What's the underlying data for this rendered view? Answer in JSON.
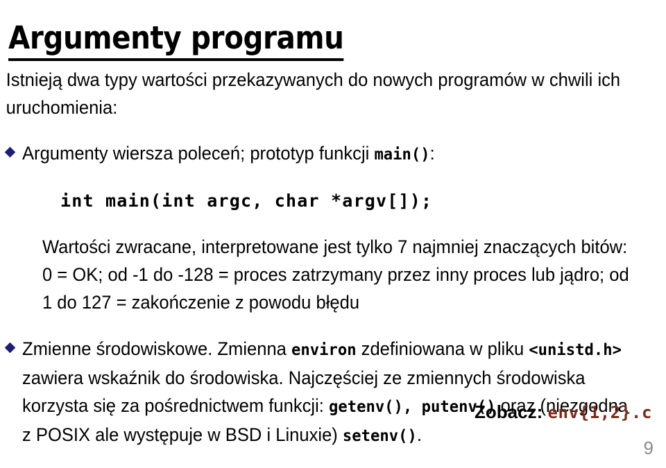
{
  "slide": {
    "title": "Argumenty programu",
    "page_number": "9",
    "bullet_color": "#1d1d78",
    "code_accent_color": "#7b2a18",
    "page_number_color": "#8a8a8a"
  },
  "intro": {
    "text": "Istnieją dwa typy wartości przekazywanych do nowych programów w chwili ich uruchomienia:"
  },
  "bullets": [
    {
      "lead_text": "Argumenty wiersza poleceń; prototyp funkcji ",
      "lead_mono": "main()",
      "lead_tail": ":",
      "code_line": "int main(int argc, char *argv[]);",
      "sub_text": "Wartości zwracane, interpretowane jest tylko 7 najmniej znaczących bitów: 0 = OK; od -1 do -128 = proces zatrzymany przez inny proces lub jądro; od 1 do 127 = zakończenie z powodu błędu"
    },
    {
      "seg_1": "Zmienne środowiskowe. Zmienna ",
      "mono_1": "environ",
      "seg_2": " zdefiniowana w pliku ",
      "mono_2": "<unistd.h>",
      "seg_3": " zawiera wskaźnik do środowiska. Najczęściej ze zmiennych środowiska korzysta się za pośrednictwem funkcji: ",
      "mono_3": "getenv(), putenv()",
      "seg_4": " oraz (niezgodna z POSIX ale występuje w BSD i Linuxie) ",
      "mono_4": "setenv()",
      "seg_5": "."
    }
  ],
  "see_also": {
    "label": "Zobacz:",
    "target": "env{1,2}.c"
  }
}
